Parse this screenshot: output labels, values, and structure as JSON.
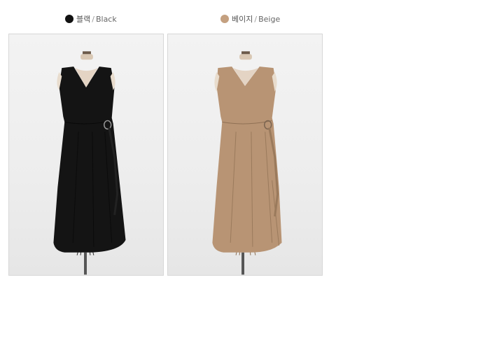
{
  "variants": [
    {
      "name_ko": "블랙",
      "separator": "/",
      "name_en": "Black",
      "swatch_color": "#111111",
      "dress_color": "#141414",
      "dress_shadow": "#050505",
      "image_description_icon": "dress-photo-black"
    },
    {
      "name_ko": "베이지",
      "separator": "/",
      "name_en": "Beige",
      "swatch_color": "#c4a080",
      "dress_color": "#b89474",
      "dress_shadow": "#9a7a5c",
      "image_description_icon": "dress-photo-beige"
    }
  ]
}
